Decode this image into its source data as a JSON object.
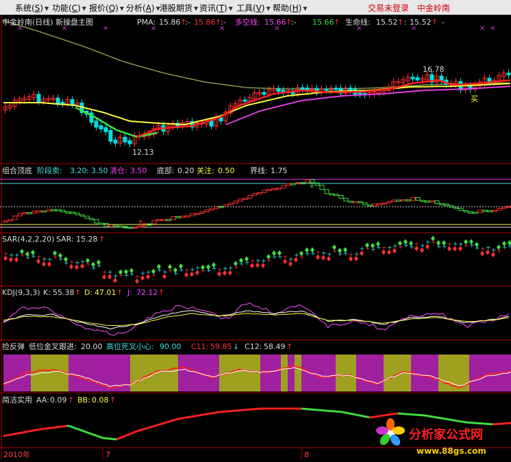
{
  "menu": {
    "items": [
      {
        "label": "系统",
        "key": "S"
      },
      {
        "label": "功能",
        "key": "C"
      },
      {
        "label": "报价",
        "key": "Q"
      },
      {
        "label": "分析",
        "key": "A"
      },
      {
        "label": "港股期货",
        "key": ""
      },
      {
        "label": "资讯",
        "key": "T"
      },
      {
        "label": "工具",
        "key": "V"
      },
      {
        "label": "帮助",
        "key": "H"
      }
    ],
    "status_login": "交易未登录",
    "status_stock": "中金岭南"
  },
  "main": {
    "title": "中金岭南(日线) 新操盘主图",
    "pma_label": "PMA:",
    "pma_value": "15.86",
    "pma_value2": "15.86",
    "sep": ":-",
    "duokong_label": "多空线:",
    "duokong_value": "15.66",
    "duokong_value2": "15.66",
    "life_label": "生命线:",
    "life_value": "15.52",
    "life_value2": "15.52",
    "tail": "-",
    "high_label": "16.78",
    "low_label": "12.13",
    "buy_label": "买"
  },
  "panel2": {
    "title": "组合顶底",
    "jieduan_label": "阶段卖:",
    "jieduan_value": "3.20",
    "jieduan_value2": "3.50",
    "qingcang_label": "清仓:",
    "qingcang_value": "3.50",
    "dibu_label": "底部:",
    "dibu_value": "0.20",
    "guanzhu_label": "关注:",
    "guanzhu_value": "0.50",
    "jiexian_label": "界线:",
    "jiexian_value": "1.75"
  },
  "panel3": {
    "title": "SAR(4,2,2,20)",
    "sar_label": "SAR:",
    "sar_value": "15.28"
  },
  "panel4": {
    "title": "KDJ(9,3,3)",
    "k_label": "K:",
    "k_value": "55.38",
    "d_label": "D:",
    "d_value": "47.01",
    "j_label": "J:",
    "j_value": "72.12"
  },
  "panel5": {
    "title": "捡反弹",
    "diwei_label": "低位金叉跟进:",
    "diwei_value": "20.00",
    "gaowei_label": "高位死叉小心:",
    "gaowei_value": "90.00",
    "c11_label": "C11:",
    "c11_value": "59.85",
    "c12_label": "C12:",
    "c12_value": "58.49"
  },
  "panel6": {
    "title": "简洁实用",
    "aa_label": "AA:",
    "aa_value": "0.09",
    "bb_label": "BB:",
    "bb_value": "0.08"
  },
  "xaxis": {
    "labels": [
      "2010年",
      "7",
      "8"
    ]
  },
  "watermark": {
    "text": "分析家公式网",
    "url": "www.88gs.com"
  },
  "colors": {
    "bg": "#000000",
    "up": "#ff3030",
    "down": "#00e0e0",
    "yellow": "#ffff40",
    "green": "#40e040",
    "magenta": "#e040e0",
    "purple_band": "#a020a0",
    "olive_band": "#a0a020"
  }
}
